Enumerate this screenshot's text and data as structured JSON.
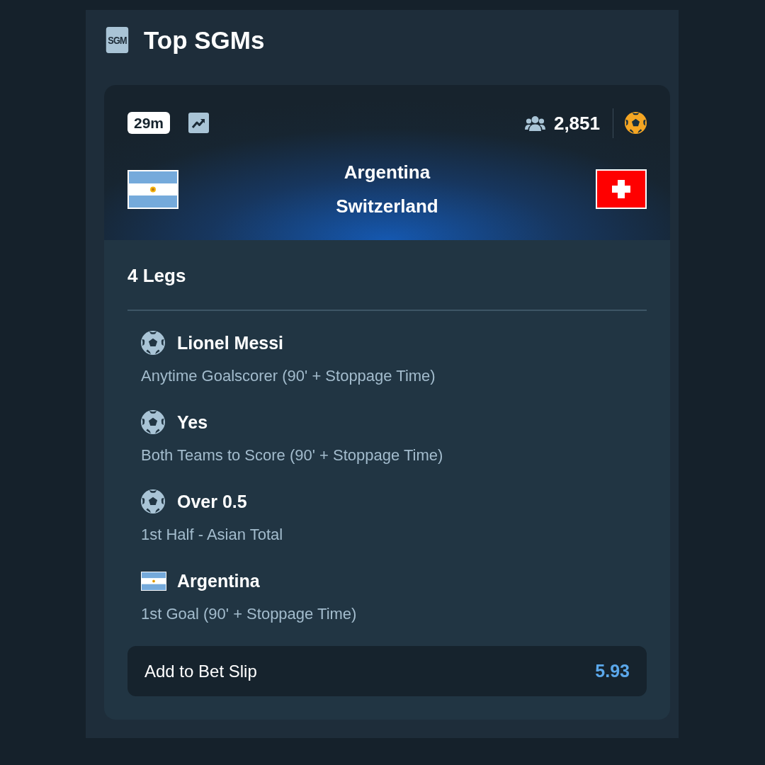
{
  "header": {
    "logo_text": "SGM",
    "title": "Top SGMs"
  },
  "match": {
    "time_badge": "29m",
    "bettors": "2,851",
    "home": {
      "name": "Argentina"
    },
    "away": {
      "name": "Switzerland"
    }
  },
  "legs_count": "4 Legs",
  "legs": [
    {
      "kind": "ball",
      "title": "Lionel Messi",
      "market": "Anytime Goalscorer (90' + Stoppage Time)"
    },
    {
      "kind": "ball",
      "title": "Yes",
      "market": "Both Teams to Score (90' + Stoppage Time)"
    },
    {
      "kind": "ball",
      "title": "Over 0.5",
      "market": "1st Half - Asian Total"
    },
    {
      "kind": "home_flag",
      "title": "Argentina",
      "market": "1st Goal (90' + Stoppage Time)"
    }
  ],
  "bet_button": {
    "label": "Add to Bet Slip",
    "odds": "5.93"
  }
}
